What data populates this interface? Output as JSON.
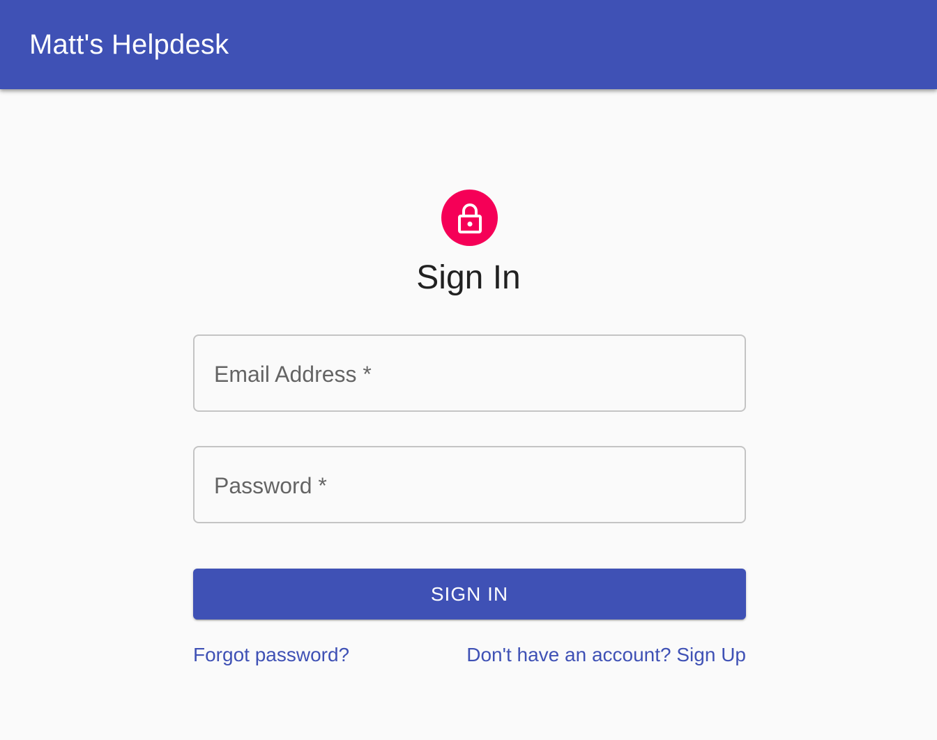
{
  "app": {
    "title": "Matt's Helpdesk"
  },
  "header": {
    "icon": "lock-icon",
    "title": "Sign In"
  },
  "form": {
    "email": {
      "label": "Email Address *",
      "value": ""
    },
    "password": {
      "label": "Password *",
      "value": ""
    },
    "submit_label": "SIGN IN"
  },
  "links": {
    "forgot_password": "Forgot password?",
    "sign_up": "Don't have an account? Sign Up"
  },
  "colors": {
    "primary": "#3f51b5",
    "secondary": "#f50057",
    "background": "#fafafa"
  }
}
